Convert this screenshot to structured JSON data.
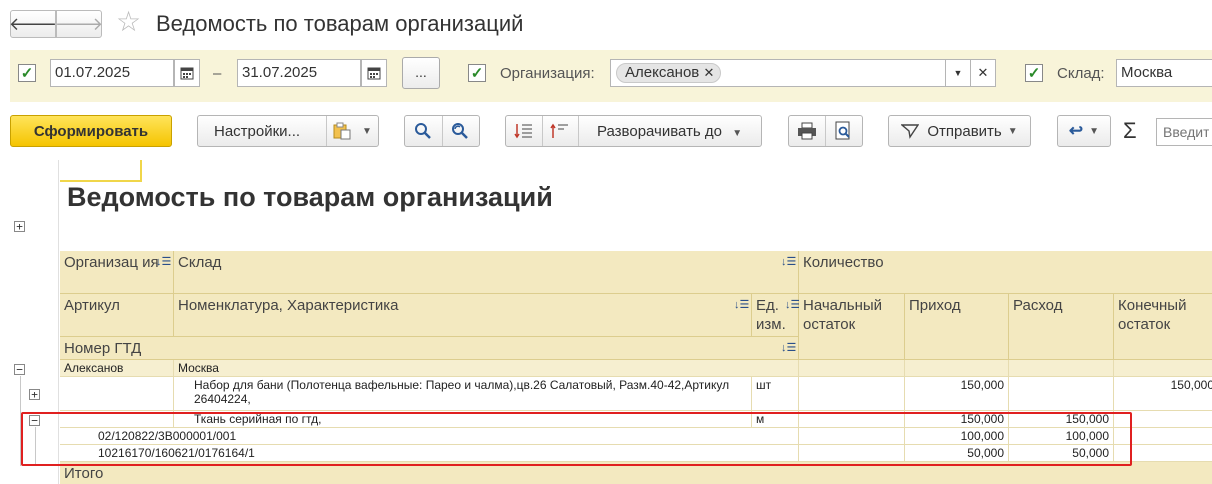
{
  "header": {
    "title": "Ведомость по товарам организаций"
  },
  "filters": {
    "date_from": "01.07.2025",
    "date_sep": "–",
    "date_to": "31.07.2025",
    "more_label": "...",
    "org_label": "Организация:",
    "org_value": "Алексанов",
    "warehouse_label": "Склад:",
    "warehouse_value": "Москва"
  },
  "toolbar": {
    "generate": "Сформировать",
    "settings": "Настройки...",
    "expand_to": "Разворачивать до",
    "send": "Отправить",
    "search_placeholder": "Введите"
  },
  "report": {
    "title": "Ведомость по товарам организаций",
    "headers": {
      "org": "Организац ия",
      "warehouse": "Склад",
      "quantity": "Количество",
      "article": "Артикул",
      "nomenclature": "Номенклатура, Характеристика",
      "unit": "Ед. изм.",
      "opening": "Начальный остаток",
      "income": "Приход",
      "expense": "Расход",
      "closing": "Конечный остаток",
      "gtd": "Номер ГТД"
    },
    "group": {
      "org": "Алексанов",
      "warehouse": "Москва"
    },
    "rows": [
      {
        "name": "Набор для бани (Полотенца вафельные: Парео и чалма),цв.26 Салатовый, Разм.40-42,Артикул 26404224,",
        "unit": "шт",
        "income": "150,000",
        "expense": "",
        "closing": "150,000"
      },
      {
        "name": "Ткань серийная по гтд,",
        "unit": "м",
        "income": "150,000",
        "expense": "150,000",
        "closing": ""
      }
    ],
    "gtd_rows": [
      {
        "gtd": "02/120822/3В000001/001",
        "income": "100,000",
        "expense": "100,000"
      },
      {
        "gtd": "10216170/160621/0176164/1",
        "income": "50,000",
        "expense": "50,000"
      }
    ],
    "total_label": "Итого"
  }
}
